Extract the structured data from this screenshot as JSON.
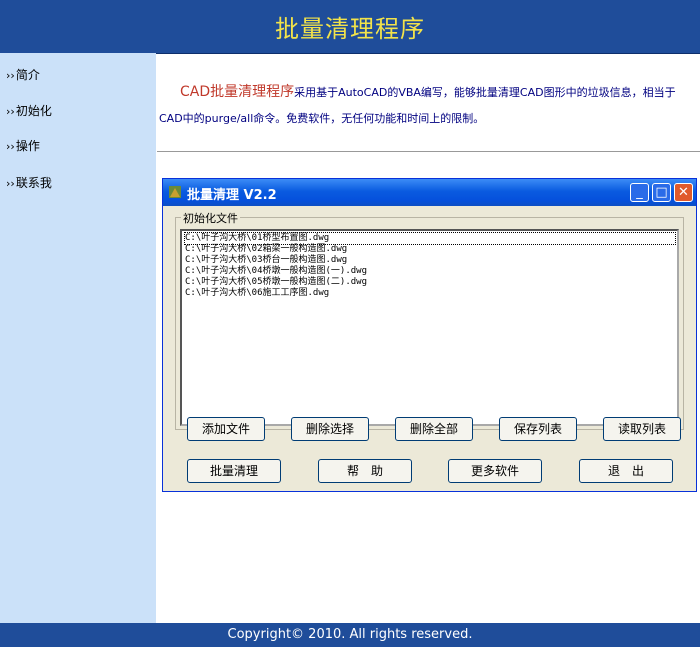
{
  "header": {
    "title": "批量清理程序"
  },
  "sidebar": {
    "items": [
      {
        "arrow": "››",
        "label": "简介"
      },
      {
        "arrow": "››",
        "label": "初始化"
      },
      {
        "arrow": "››",
        "label": "操作"
      },
      {
        "arrow": "››",
        "label": "联系我"
      }
    ]
  },
  "intro": {
    "highlight": "CAD批量清理程序",
    "text": "采用基于AutoCAD的VBA编写，能够批量清理CAD图形中的垃圾信息，相当于CAD中的purge/all命令。免费软件，无任何功能和时间上的限制。"
  },
  "dialog": {
    "title": "批量清理 V2.2",
    "group_label": "初始化文件",
    "files": [
      "C:\\叶子沟大桥\\01桥型布置图.dwg",
      "C:\\叶子沟大桥\\02箱梁一般构造图.dwg",
      "C:\\叶子沟大桥\\03桥台一般构造图.dwg",
      "C:\\叶子沟大桥\\04桥墩一般构造图(一).dwg",
      "C:\\叶子沟大桥\\05桥墩一般构造图(二).dwg",
      "C:\\叶子沟大桥\\06施工工序图.dwg"
    ],
    "buttons_row1": [
      "添加文件",
      "删除选择",
      "删除全部",
      "保存列表",
      "读取列表"
    ],
    "buttons_row2": [
      "批量清理",
      "帮　助",
      "更多软件",
      "退　出"
    ],
    "window_buttons": {
      "minimize": "_",
      "maximize": "□",
      "close": "✕"
    }
  },
  "footer": {
    "copyright": "Copyright© 2010.  All rights reserved."
  },
  "colors": {
    "header_bg": "#1f4d9a",
    "title_color": "#f2e34a",
    "sidebar_bg": "#cbe1f9",
    "intro_text": "#000080",
    "intro_highlight": "#c0392b"
  }
}
